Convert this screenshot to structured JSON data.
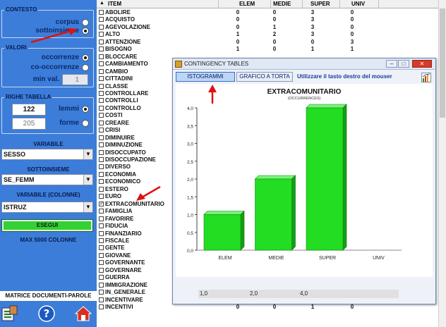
{
  "left": {
    "contesto": {
      "title": "CONTESTO",
      "options": [
        {
          "label": "corpus",
          "selected": false
        },
        {
          "label": "sottoinsieme",
          "selected": true
        }
      ]
    },
    "valori": {
      "title": "VALORI",
      "options": [
        {
          "label": "occorrenze",
          "selected": true
        },
        {
          "label": "co-occorrenze",
          "selected": false
        }
      ],
      "min_label": "min val.",
      "min_value": "1"
    },
    "righe": {
      "title": "RIGHE TABELLA",
      "lemmi_value": "122",
      "lemmi_label": "lemmi",
      "forme_value": "205",
      "forme_label": "forme"
    },
    "variabile_title": "VARIABILE",
    "variabile_value": "SESSO",
    "sottoinsieme_title": "SOTTOINSIEME",
    "sottoinsieme_value": "SE_FEMM",
    "variabile_colonne_title": "VARIABILE (COLONNE)",
    "variabile_colonne_value": "ISTRUZ",
    "esegui_label": "ESEGUI",
    "max_label": "MAX 5000 COLONNE",
    "matrix_label": "MATRICE DOCUMENTI-PAROLE"
  },
  "list": {
    "headers": [
      "ITEM",
      "ELEM",
      "MEDIE",
      "SUPER",
      "UNIV"
    ],
    "rows": [
      {
        "item": "ABOLIRE",
        "checked": false,
        "vals": [
          "0",
          "0",
          "3",
          "0"
        ]
      },
      {
        "item": "ACQUISTO",
        "checked": false,
        "vals": [
          "0",
          "0",
          "3",
          "0"
        ]
      },
      {
        "item": "AGEVOLAZIONE",
        "checked": false,
        "vals": [
          "0",
          "1",
          "3",
          "0"
        ]
      },
      {
        "item": "ALTO",
        "checked": false,
        "vals": [
          "1",
          "2",
          "3",
          "0"
        ]
      },
      {
        "item": "ATTENZIONE",
        "checked": false,
        "vals": [
          "0",
          "0",
          "0",
          "3"
        ]
      },
      {
        "item": "BISOGNO",
        "checked": false,
        "vals": [
          "1",
          "0",
          "1",
          "1"
        ]
      },
      {
        "item": "BLOCCARE",
        "checked": false,
        "vals": [
          "",
          "",
          "",
          ""
        ]
      },
      {
        "item": "CAMBIAMENTO",
        "checked": false,
        "vals": [
          "",
          "",
          "",
          ""
        ]
      },
      {
        "item": "CAMBIO",
        "checked": false,
        "vals": [
          "",
          "",
          "",
          ""
        ]
      },
      {
        "item": "CITTADINI",
        "checked": false,
        "vals": [
          "",
          "",
          "",
          ""
        ]
      },
      {
        "item": "CLASSE",
        "checked": false,
        "vals": [
          "",
          "",
          "",
          ""
        ]
      },
      {
        "item": "CONTROLLARE",
        "checked": false,
        "vals": [
          "",
          "",
          "",
          ""
        ]
      },
      {
        "item": "CONTROLLI",
        "checked": false,
        "vals": [
          "",
          "",
          "",
          ""
        ]
      },
      {
        "item": "CONTROLLO",
        "checked": false,
        "vals": [
          "",
          "",
          "",
          ""
        ]
      },
      {
        "item": "COSTI",
        "checked": false,
        "vals": [
          "",
          "",
          "",
          ""
        ]
      },
      {
        "item": "CREARE",
        "checked": false,
        "vals": [
          "",
          "",
          "",
          ""
        ]
      },
      {
        "item": "CRISI",
        "checked": false,
        "vals": [
          "",
          "",
          "",
          ""
        ]
      },
      {
        "item": "DIMINUIRE",
        "checked": false,
        "vals": [
          "",
          "",
          "",
          ""
        ]
      },
      {
        "item": "DIMINUZIONE",
        "checked": false,
        "vals": [
          "",
          "",
          "",
          ""
        ]
      },
      {
        "item": "DISOCCUPATO",
        "checked": false,
        "vals": [
          "",
          "",
          "",
          ""
        ]
      },
      {
        "item": "DISOCCUPAZIONE",
        "checked": false,
        "vals": [
          "",
          "",
          "",
          ""
        ]
      },
      {
        "item": "DIVERSO",
        "checked": false,
        "vals": [
          "",
          "",
          "",
          ""
        ]
      },
      {
        "item": "ECONOMIA",
        "checked": false,
        "vals": [
          "",
          "",
          "",
          ""
        ]
      },
      {
        "item": "ECONOMICO",
        "checked": false,
        "vals": [
          "",
          "",
          "",
          ""
        ]
      },
      {
        "item": "ESTERO",
        "checked": false,
        "vals": [
          "",
          "",
          "",
          ""
        ]
      },
      {
        "item": "EURO",
        "checked": false,
        "vals": [
          "",
          "",
          "",
          ""
        ]
      },
      {
        "item": "EXTRACOMUNITARIO",
        "checked": true,
        "vals": [
          "",
          "",
          "",
          ""
        ]
      },
      {
        "item": "FAMIGLIA",
        "checked": false,
        "vals": [
          "",
          "",
          "",
          ""
        ]
      },
      {
        "item": "FAVORIRE",
        "checked": false,
        "vals": [
          "",
          "",
          "",
          ""
        ]
      },
      {
        "item": "FIDUCIA",
        "checked": false,
        "vals": [
          "",
          "",
          "",
          ""
        ]
      },
      {
        "item": "FINANZIARIO",
        "checked": false,
        "vals": [
          "",
          "",
          "",
          ""
        ]
      },
      {
        "item": "FISCALE",
        "checked": false,
        "vals": [
          "",
          "",
          "",
          ""
        ]
      },
      {
        "item": "GENTE",
        "checked": false,
        "vals": [
          "",
          "",
          "",
          ""
        ]
      },
      {
        "item": "GIOVANE",
        "checked": false,
        "vals": [
          "",
          "",
          "",
          ""
        ]
      },
      {
        "item": "GOVERNANTE",
        "checked": false,
        "vals": [
          "",
          "",
          "",
          ""
        ]
      },
      {
        "item": "GOVERNARE",
        "checked": false,
        "vals": [
          "",
          "",
          "",
          ""
        ]
      },
      {
        "item": "GUERRA",
        "checked": false,
        "vals": [
          "",
          "",
          "",
          ""
        ]
      },
      {
        "item": "IMMIGRAZIONE",
        "checked": false,
        "vals": [
          "",
          "",
          "",
          ""
        ]
      },
      {
        "item": "IN_GENERALE",
        "checked": false,
        "vals": [
          "",
          "",
          "",
          ""
        ]
      },
      {
        "item": "INCENTIVARE",
        "checked": false,
        "vals": [
          "",
          "",
          "",
          ""
        ]
      },
      {
        "item": "INCENTIVI",
        "checked": false,
        "vals": [
          "0",
          "0",
          "1",
          "0"
        ]
      }
    ]
  },
  "dialog": {
    "title": "CONTINGENCY TABLES",
    "tab_istogrammi": "ISTOGRAMMI",
    "tab_torta": "GRAFICO A TORTA",
    "hint": "Utilizzare il tasto destro del mouser",
    "value_strip": [
      "1,0",
      "2,0",
      "4,0"
    ]
  },
  "chart_data": {
    "type": "bar",
    "title": "EXTRACOMUNITARIO",
    "subtitle": "(OCCURRENCES)",
    "categories": [
      "ELEM",
      "MEDIE",
      "SUPER",
      "UNIV"
    ],
    "values": [
      1,
      2,
      4,
      0
    ],
    "yticks": [
      "0,0",
      "0,5",
      "1,0",
      "1,5",
      "2,0",
      "2,5",
      "3,0",
      "3,5",
      "4,0"
    ],
    "ylim": [
      0,
      4
    ],
    "bar_color": "#22dd22",
    "grid": false,
    "legend": "none"
  },
  "colors": {
    "panel": "#3c7dd9",
    "esegui": "#34d134",
    "arrow": "#e01010"
  }
}
